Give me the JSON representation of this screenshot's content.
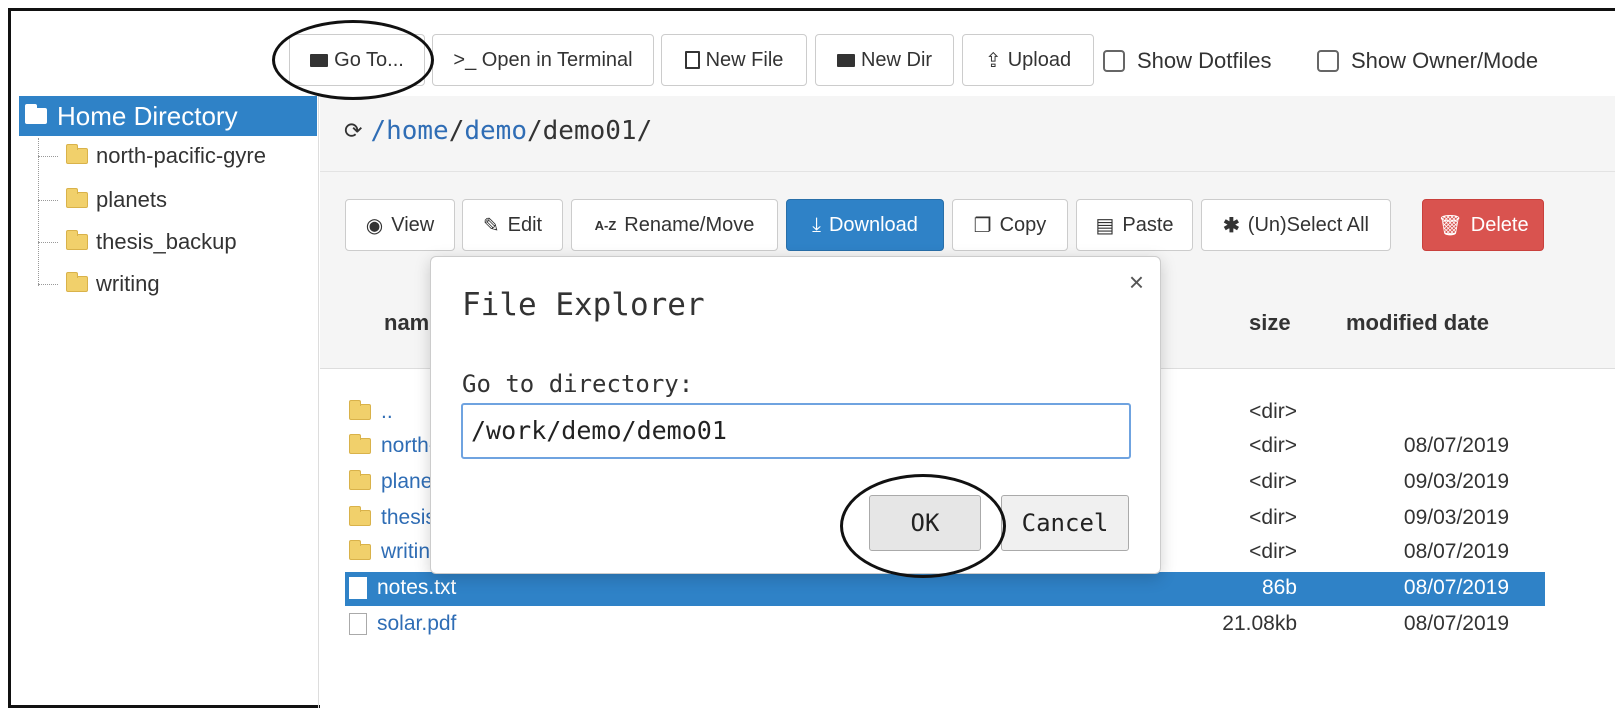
{
  "toolbar": {
    "goto_label": "Go To...",
    "terminal_label": ">_ Open in Terminal",
    "new_file_label": "New File",
    "new_dir_label": "New Dir",
    "upload_label": "Upload",
    "show_dotfiles_label": "Show Dotfiles",
    "show_owner_label": "Show Owner/Mode"
  },
  "sidebar": {
    "home_label": "Home Directory",
    "items": [
      {
        "label": "north-pacific-gyre"
      },
      {
        "label": "planets"
      },
      {
        "label": "thesis_backup"
      },
      {
        "label": "writing"
      }
    ]
  },
  "path": {
    "root": "/",
    "seg1": "home",
    "seg2": "demo",
    "seg3": "demo01",
    "sep": "/"
  },
  "actions": {
    "view": "View",
    "edit": "Edit",
    "rename": "Rename/Move",
    "download": "Download",
    "copy": "Copy",
    "paste": "Paste",
    "select_all": "(Un)Select All",
    "delete": "Delete"
  },
  "table": {
    "col_name": "name",
    "col_size": "size",
    "col_date": "modified date",
    "rows": [
      {
        "name": "..",
        "size": "<dir>",
        "date": ""
      },
      {
        "name": "north-pacific-gyre",
        "size": "<dir>",
        "date": "08/07/2019"
      },
      {
        "name": "planets",
        "size": "<dir>",
        "date": "09/03/2019"
      },
      {
        "name": "thesis_backup",
        "size": "<dir>",
        "date": "09/03/2019"
      },
      {
        "name": "writing",
        "size": "<dir>",
        "date": "08/07/2019"
      },
      {
        "name": "notes.txt",
        "size": "86b",
        "date": "08/07/2019"
      },
      {
        "name": "solar.pdf",
        "size": "21.08kb",
        "date": "08/07/2019"
      }
    ]
  },
  "modal": {
    "title": "File Explorer",
    "close": "×",
    "label": "Go to directory:",
    "input_value": "/work/demo/demo01",
    "ok": "OK",
    "cancel": "Cancel"
  },
  "colors": {
    "accent": "#2f82c7",
    "danger": "#d9534f",
    "folder": "#f1d06b"
  }
}
